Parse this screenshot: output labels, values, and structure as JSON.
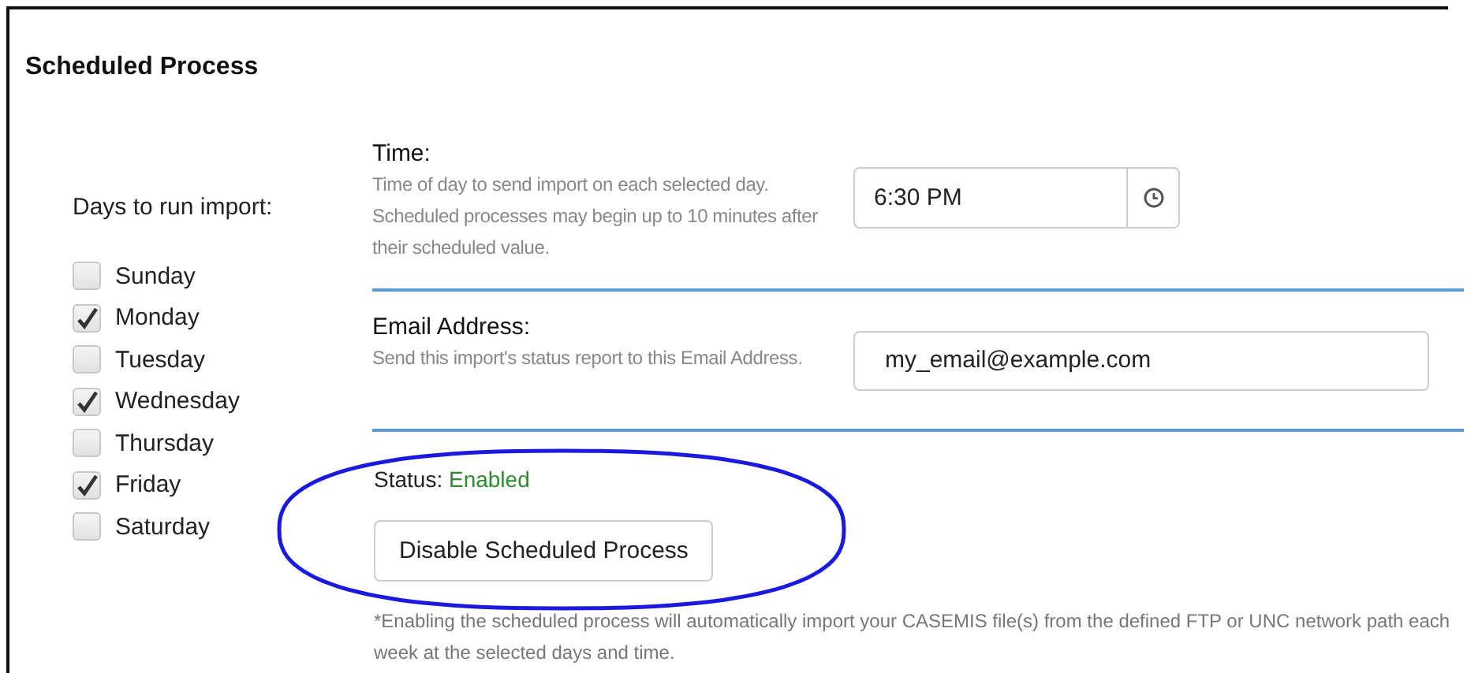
{
  "title": "Scheduled Process",
  "days": {
    "label": "Days to run import:",
    "items": [
      {
        "label": "Sunday",
        "checked": false
      },
      {
        "label": "Monday",
        "checked": true
      },
      {
        "label": "Tuesday",
        "checked": false
      },
      {
        "label": "Wednesday",
        "checked": true
      },
      {
        "label": "Thursday",
        "checked": false
      },
      {
        "label": "Friday",
        "checked": true
      },
      {
        "label": "Saturday",
        "checked": false
      }
    ]
  },
  "time": {
    "label": "Time:",
    "help": "Time of day to send import on each selected day. Scheduled processes may begin up to 10 minutes after their scheduled value.",
    "value": "6:30 PM"
  },
  "email": {
    "label": "Email Address:",
    "help": "Send this import's status report to this Email Address.",
    "value": "my_email@example.com"
  },
  "status": {
    "label": "Status:",
    "value": "Enabled",
    "kind": "enabled"
  },
  "button": "Disable Scheduled Process",
  "note": "*Enabling the scheduled process will automatically import your CASEMIS file(s) from the defined FTP or UNC network path each week at the selected days and time."
}
